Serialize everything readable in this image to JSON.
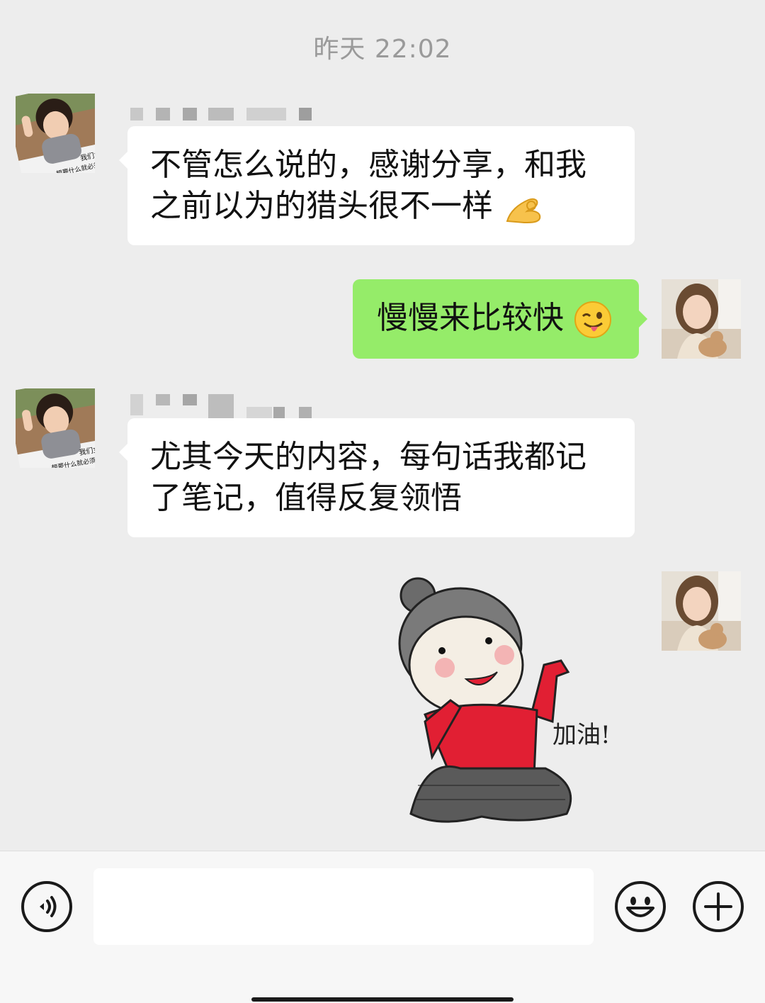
{
  "chat": {
    "timestamp": "昨天 22:02",
    "messages": [
      {
        "side": "left",
        "lines": [
          "不管怎么说的，感谢分享，和我",
          "之前以为的猎头很不一样"
        ],
        "trailing_emoji": "ok-hand-emoji",
        "avatar": "toddler-meme-avatar",
        "avatar_caption": [
          "我们女人",
          "想要什么就必须搞到手"
        ]
      },
      {
        "side": "right",
        "lines": [
          "慢慢来比较快"
        ],
        "trailing_emoji": "winking-tongue-emoji",
        "avatar": "woman-with-cat-avatar"
      },
      {
        "side": "left",
        "lines": [
          "尤其今天的内容，每句话我都记",
          "了笔记，值得反复领悟"
        ],
        "avatar": "toddler-meme-avatar",
        "avatar_caption": [
          "我们女人",
          "想要什么就必须搞到手"
        ]
      },
      {
        "side": "right",
        "type": "sticker",
        "sticker_text": "加油!",
        "avatar": "woman-with-cat-avatar"
      }
    ]
  },
  "input_bar": {
    "voice_icon": "voice-icon",
    "input_value": "",
    "emoji_icon": "smiley-icon",
    "plus_icon": "plus-icon"
  },
  "colors": {
    "background": "#ededed",
    "sent_bubble": "#95ec69",
    "received_bubble": "#ffffff",
    "timestamp": "#9a9a9a"
  }
}
